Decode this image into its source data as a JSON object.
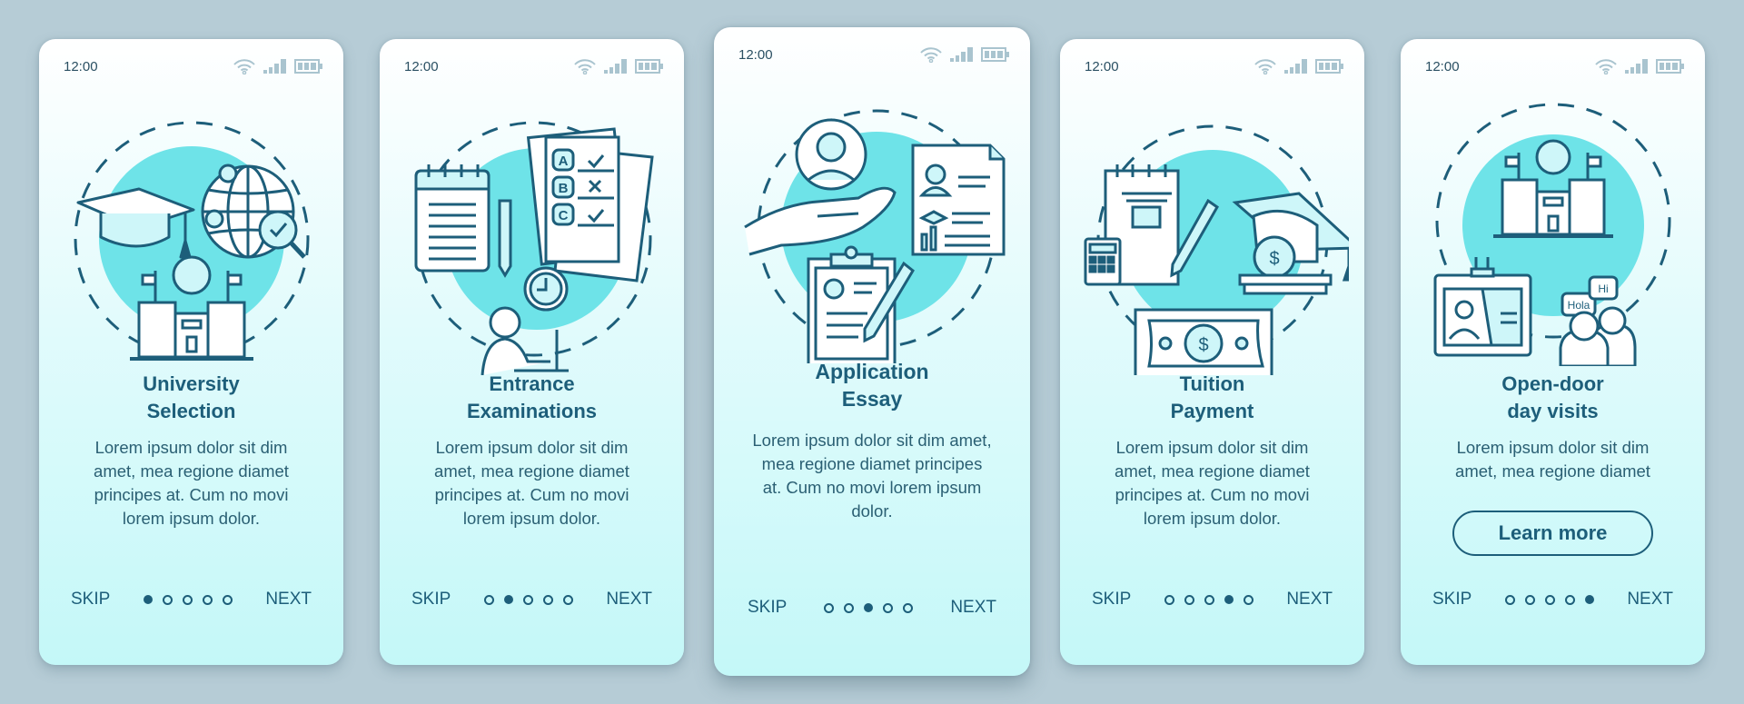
{
  "colors": {
    "background": "#b6ccd6",
    "primary": "#1d5e7a",
    "accent_circle": "#6ee3e8",
    "status_icon": "#a9c4cf"
  },
  "status_bar": {
    "time": "12:00",
    "icons": [
      "wifi-icon",
      "signal-icon",
      "battery-icon"
    ]
  },
  "nav": {
    "skip_label": "SKIP",
    "next_label": "NEXT",
    "total_steps": 5
  },
  "screens": [
    {
      "title_line1": "University",
      "title_line2": "Selection",
      "body": "Lorem ipsum dolor sit dim amet, mea regione diamet principes at. Cum no movi lorem ipsum dolor.",
      "active_step": 1,
      "illustration_icons": [
        "graduation-cap-icon",
        "globe-search-icon",
        "university-building-icon"
      ]
    },
    {
      "title_line1": "Entrance",
      "title_line2": "Examinations",
      "body": "Lorem ipsum dolor sit dim amet, mea regione diamet principes at. Cum no movi lorem ipsum dolor.",
      "active_step": 2,
      "illustration_icons": [
        "notepad-icon",
        "pencil-icon",
        "test-sheet-icon",
        "clock-icon",
        "student-laptop-icon"
      ],
      "test_options": [
        "A",
        "B",
        "C"
      ]
    },
    {
      "title_line1": "Application",
      "title_line2": "Essay",
      "body": "Lorem ipsum dolor sit dim amet, mea regione diamet principes at. Cum no movi lorem ipsum dolor.",
      "active_step": 3,
      "illustration_icons": [
        "hand-person-icon",
        "resume-icon",
        "clipboard-pencil-icon"
      ]
    },
    {
      "title_line1": "Tuition",
      "title_line2": "Payment",
      "body": "Lorem ipsum dolor sit dim amet, mea regione diamet principes at. Cum no movi lorem ipsum dolor.",
      "active_step": 4,
      "illustration_icons": [
        "calendar-icon",
        "calculator-icon",
        "graduation-cap-coins-icon",
        "banknote-icon"
      ]
    },
    {
      "title_line1": "Open-door",
      "title_line2": "day visits",
      "body": "Lorem ipsum dolor sit dim amet, mea regione diamet",
      "active_step": 5,
      "button_label": "Learn more",
      "illustration_icons": [
        "university-building-icon",
        "id-badge-icon",
        "people-greeting-icon"
      ],
      "speech_bubbles": [
        "Hola",
        "Hi"
      ]
    }
  ]
}
